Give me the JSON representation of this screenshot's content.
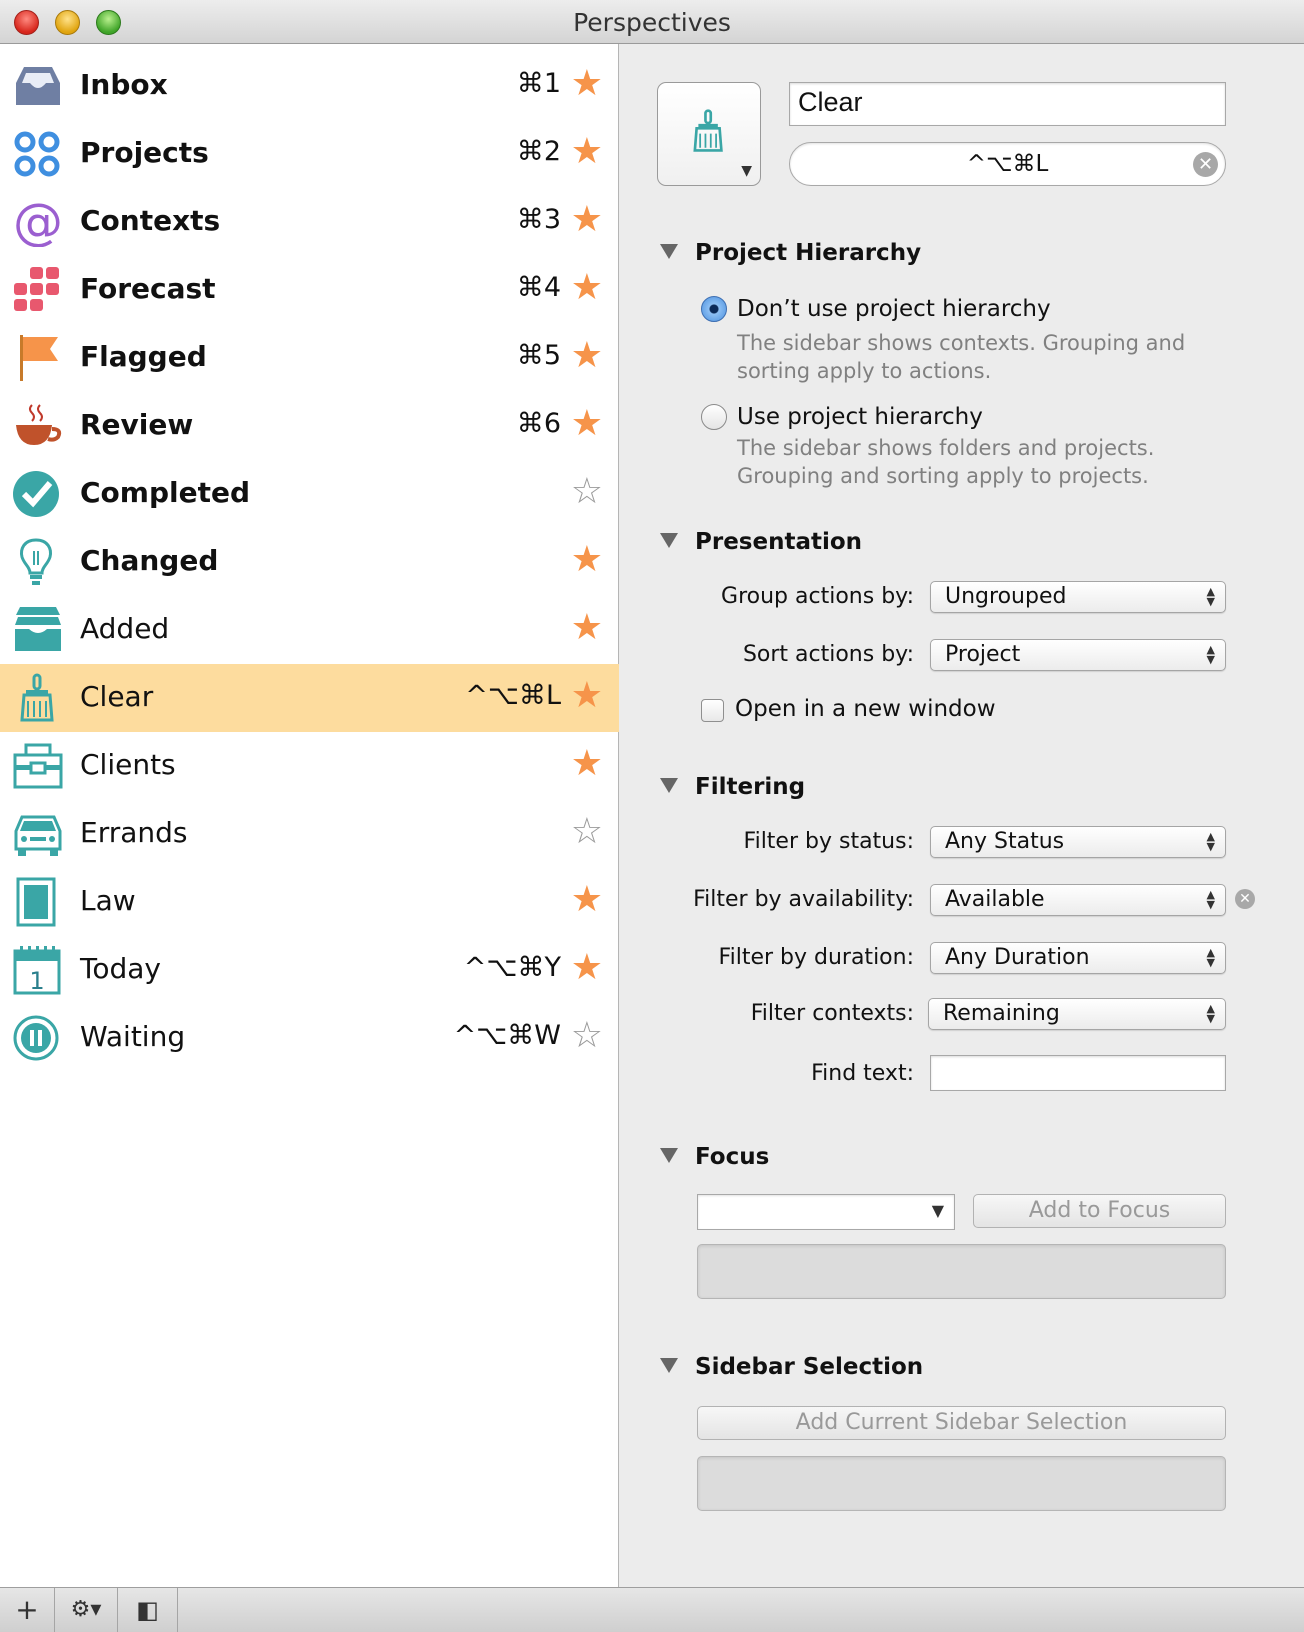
{
  "window": {
    "title": "Perspectives"
  },
  "sidebar": {
    "items": [
      {
        "label": "Inbox",
        "shortcut": "⌘1",
        "starred": true,
        "bold": true,
        "icon": "inbox-icon"
      },
      {
        "label": "Projects",
        "shortcut": "⌘2",
        "starred": true,
        "bold": true,
        "icon": "projects-icon"
      },
      {
        "label": "Contexts",
        "shortcut": "⌘3",
        "starred": true,
        "bold": true,
        "icon": "at-sign-icon"
      },
      {
        "label": "Forecast",
        "shortcut": "⌘4",
        "starred": true,
        "bold": true,
        "icon": "forecast-grid-icon"
      },
      {
        "label": "Flagged",
        "shortcut": "⌘5",
        "starred": true,
        "bold": true,
        "icon": "flag-icon"
      },
      {
        "label": "Review",
        "shortcut": "⌘6",
        "starred": true,
        "bold": true,
        "icon": "coffee-cup-icon"
      },
      {
        "label": "Completed",
        "shortcut": "",
        "starred": false,
        "bold": true,
        "icon": "checkmark-icon"
      },
      {
        "label": "Changed",
        "shortcut": "",
        "starred": true,
        "bold": true,
        "icon": "lightbulb-icon"
      },
      {
        "label": "Added",
        "shortcut": "",
        "starred": true,
        "bold": false,
        "icon": "stacked-trays-icon"
      },
      {
        "label": "Clear",
        "shortcut": "^⌥⌘L",
        "starred": true,
        "bold": false,
        "icon": "broom-icon",
        "selected": true
      },
      {
        "label": "Clients",
        "shortcut": "",
        "starred": true,
        "bold": false,
        "icon": "briefcase-icon"
      },
      {
        "label": "Errands",
        "shortcut": "",
        "starred": false,
        "bold": false,
        "icon": "car-icon"
      },
      {
        "label": "Law",
        "shortcut": "",
        "starred": true,
        "bold": false,
        "icon": "book-icon"
      },
      {
        "label": "Today",
        "shortcut": "^⌥⌘Y",
        "starred": true,
        "bold": false,
        "icon": "calendar-icon",
        "calendar_day": "1"
      },
      {
        "label": "Waiting",
        "shortcut": "^⌥⌘W",
        "starred": false,
        "bold": false,
        "icon": "pause-icon"
      }
    ],
    "star_on": "★",
    "star_off": "☆"
  },
  "toolbar": {
    "add_label": "+",
    "gear_label": "⚙▾",
    "collapse_label": "◧"
  },
  "detail": {
    "name_value": "Clear",
    "shortcut_value": "^⌥⌘L",
    "clear_glyph": "✕",
    "hierarchy": {
      "title": "Project Hierarchy",
      "option1_label": "Don’t use project hierarchy",
      "option1_desc": "The sidebar shows contexts. Grouping and sorting apply to actions.",
      "option2_label": "Use project hierarchy",
      "option2_desc": "The sidebar shows folders and projects. Grouping and sorting apply to projects.",
      "selected_option": 1
    },
    "presentation": {
      "title": "Presentation",
      "group_label": "Group actions by:",
      "group_value": "Ungrouped",
      "sort_label": "Sort actions by:",
      "sort_value": "Project",
      "new_window_label": "Open in a new window"
    },
    "filtering": {
      "title": "Filtering",
      "status_label": "Filter by status:",
      "status_value": "Any Status",
      "availability_label": "Filter by availability:",
      "availability_value": "Available",
      "duration_label": "Filter by duration:",
      "duration_value": "Any Duration",
      "contexts_label": "Filter contexts:",
      "contexts_value": "Remaining",
      "find_label": "Find text:",
      "find_value": ""
    },
    "focus": {
      "title": "Focus",
      "add_button": "Add to Focus"
    },
    "sidebar_selection": {
      "title": "Sidebar Selection",
      "add_button": "Add Current Sidebar Selection"
    }
  },
  "colors": {
    "selection": "#fddc9e",
    "star": "#f6944a",
    "teal_icon": "#3aa6a6"
  }
}
